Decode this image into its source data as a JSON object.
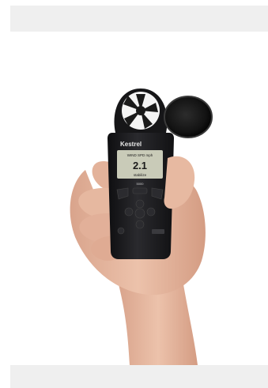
{
  "photo": {
    "subject": "handheld weather meter",
    "brand_label": "Kestrel",
    "screen": {
      "header": "WIND SPD mph",
      "value": "2.1",
      "footer": "stabilize"
    },
    "model_label": "5000",
    "colors": {
      "band": "#efefef",
      "device_body": "#1c1c1e",
      "lcd": "#c9cbb8",
      "skin": "#e7b9a1"
    }
  }
}
